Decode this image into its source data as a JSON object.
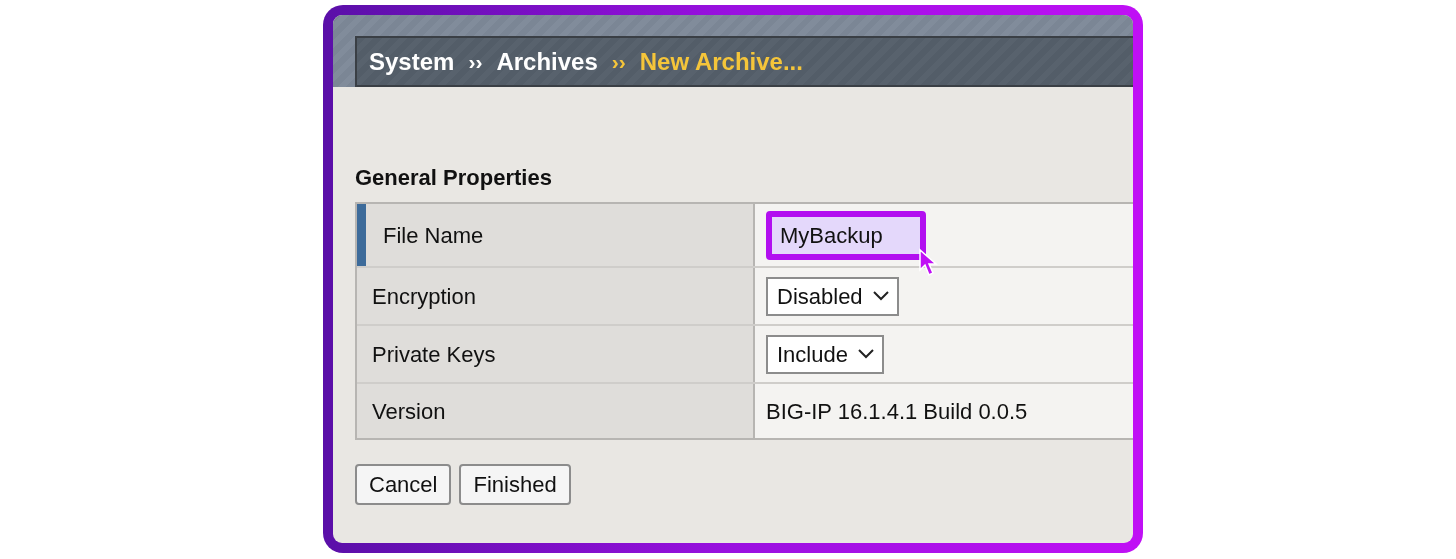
{
  "breadcrumb": [
    {
      "label": "System",
      "current": false
    },
    {
      "label": "››",
      "kind": "separator",
      "current": false
    },
    {
      "label": "Archives",
      "current": false
    },
    {
      "label": "››",
      "kind": "separator",
      "current": true
    },
    {
      "label": "New Archive...",
      "current": true
    }
  ],
  "section_title": "General Properties",
  "properties": [
    {
      "label": "File Name",
      "kind": "input",
      "value": "MyBackup",
      "required": true,
      "highlighted": true
    },
    {
      "label": "Encryption",
      "kind": "select",
      "value": "Disabled",
      "required": false,
      "highlighted": false
    },
    {
      "label": "Private Keys",
      "kind": "select",
      "value": "Include",
      "required": false,
      "highlighted": false
    },
    {
      "label": "Version",
      "kind": "static",
      "value": "BIG-IP 16.1.4.1 Build 0.0.5",
      "required": false,
      "highlighted": false
    }
  ],
  "buttons": [
    "Cancel",
    "Finished"
  ]
}
